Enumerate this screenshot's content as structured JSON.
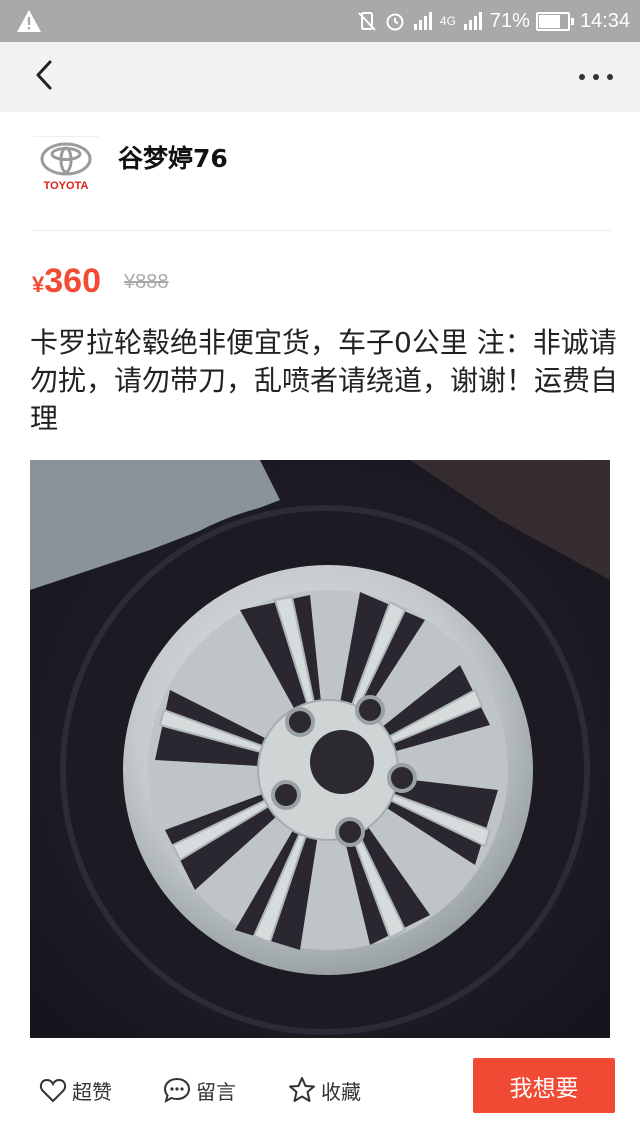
{
  "status_bar": {
    "battery": "71%",
    "time": "14:34",
    "network": "4G"
  },
  "seller": {
    "name": "谷梦婷76",
    "avatar_brand": "TOYOTA"
  },
  "listing": {
    "currency": "¥",
    "price": "360",
    "original_price": "¥888",
    "description": "卡罗拉轮毂绝非便宜货，车子0公里 注：非诚请勿扰，请勿带刀，乱喷者请绕道，谢谢！运费自理"
  },
  "actions": {
    "like": "超赞",
    "comment": "留言",
    "favorite": "收藏",
    "want": "我想要"
  },
  "colors": {
    "accent": "#f04a35",
    "price": "#f34a33",
    "toyota_red": "#e0201b"
  }
}
